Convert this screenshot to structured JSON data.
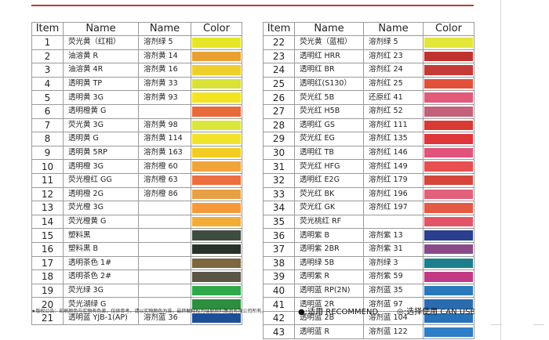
{
  "headers": {
    "item": "Item",
    "name1": "Name",
    "name2": "Name",
    "color": "Color"
  },
  "left_rows": [
    {
      "item": "1",
      "name1": "荧光黄（红相）",
      "name2": "溶剂绿 5",
      "color": "#e6e627"
    },
    {
      "item": "2",
      "name1": "油溶黄 R",
      "name2": "溶剂黄 14",
      "color": "#e8a033"
    },
    {
      "item": "3",
      "name1": "油溶黄 4R",
      "name2": "溶剂黄 16",
      "color": "#f0cf2a"
    },
    {
      "item": "4",
      "name1": "透明黄 TP",
      "name2": "溶剂黄 33",
      "color": "#d9e236"
    },
    {
      "item": "5",
      "name1": "透明黄 3G",
      "name2": "溶剂黄  93",
      "color": "#f2e51f"
    },
    {
      "item": "6",
      "name1": "透明橙黄 G",
      "name2": "",
      "color": "#e8693a"
    },
    {
      "item": "7",
      "name1": "荧光黄 3G",
      "name2": "溶剂黄 98",
      "color": "#dbe63a"
    },
    {
      "item": "8",
      "name1": "透明黄 G",
      "name2": "溶剂黄 114",
      "color": "#f2e22a"
    },
    {
      "item": "9",
      "name1": "透明黄 5RP",
      "name2": "溶剂黄 163",
      "color": "#f3cc22"
    },
    {
      "item": "10",
      "name1": "透明橙  3G",
      "name2": "溶剂橙 60",
      "color": "#f0a53a"
    },
    {
      "item": "11",
      "name1": "荧光橙红 GG",
      "name2": "溶剂橙 63",
      "color": "#ec6e3e"
    },
    {
      "item": "12",
      "name1": "透明橙  2G",
      "name2": "溶剂橙  86",
      "color": "#e8a044"
    },
    {
      "item": "13",
      "name1": "荧光橙 3G",
      "name2": "",
      "color": "#f59a3a"
    },
    {
      "item": "14",
      "name1": "荧光橙黄 G",
      "name2": "",
      "color": "#f3ad34"
    },
    {
      "item": "15",
      "name1": "塑料黑",
      "name2": "",
      "color": "#3f4d3f"
    },
    {
      "item": "16",
      "name1": "塑料黑 B",
      "name2": "",
      "color": "#27332a"
    },
    {
      "item": "17",
      "name1": "透明茶色 1#",
      "name2": "",
      "color": "#7d6840"
    },
    {
      "item": "18",
      "name1": "透明茶色 2#",
      "name2": "",
      "color": "#5b5545"
    },
    {
      "item": "19",
      "name1": "荧光绿  3G",
      "name2": "",
      "color": "#2fa84a"
    },
    {
      "item": "20",
      "name1": "荧光湖绿 G",
      "name2": "",
      "color": "#2d8f3e"
    },
    {
      "item": "21",
      "name1": "透明蓝 YJB-1(AP)",
      "name2": "溶剂蓝 36",
      "color": "#1d4f97"
    }
  ],
  "right_rows": [
    {
      "item": "22",
      "name1": "荧光黄（蓝相）",
      "name2": "溶剂绿 5",
      "color": "#e4e63a"
    },
    {
      "item": "23",
      "name1": "透明红 HRR",
      "name2": "溶剂红 23",
      "color": "#c0332f"
    },
    {
      "item": "24",
      "name1": "透明红 BR",
      "name2": "溶剂红 24",
      "color": "#c63a36"
    },
    {
      "item": "25",
      "name1": "透明红(S130）",
      "name2": "溶剂红 25",
      "color": "#e2503a"
    },
    {
      "item": "26",
      "name1": "荧光红 5B",
      "name2": "还原红 41",
      "color": "#e15a7a"
    },
    {
      "item": "27",
      "name1": "荧光红 H5B",
      "name2": "溶剂红 52",
      "color": "#c5607a"
    },
    {
      "item": "28",
      "name1": "透明红 GS",
      "name2": "溶剂红 111",
      "color": "#d93a34"
    },
    {
      "item": "29",
      "name1": "荧光红 EG",
      "name2": "溶剂红 135",
      "color": "#e0353a"
    },
    {
      "item": "30",
      "name1": "透明红 TB",
      "name2": "溶剂红 146",
      "color": "#e2527a"
    },
    {
      "item": "31",
      "name1": "荧光红 HFG",
      "name2": "溶剂红 149",
      "color": "#e65050"
    },
    {
      "item": "32",
      "name1": "透明红 E2G",
      "name2": "溶剂红 179",
      "color": "#d6453a"
    },
    {
      "item": "33",
      "name1": "荧光红 BK",
      "name2": "溶剂红 196",
      "color": "#e2607c"
    },
    {
      "item": "34",
      "name1": "荧光红 GK",
      "name2": "溶剂红 197",
      "color": "#e55a45"
    },
    {
      "item": "35",
      "name1": "荧光桃红 RF",
      "name2": "",
      "color": "#e45468"
    },
    {
      "item": "36",
      "name1": "透明紫 B",
      "name2": "溶剂紫 13",
      "color": "#2b3f8f"
    },
    {
      "item": "37",
      "name1": "透明紫 2BR",
      "name2": "溶剂紫 31",
      "color": "#8a4a8a"
    },
    {
      "item": "38",
      "name1": "透明绿 5B",
      "name2": "溶剂绿 3",
      "color": "#1c7f8e"
    },
    {
      "item": "39",
      "name1": "透明紫 R",
      "name2": "溶剂紫 59",
      "color": "#c23a84"
    },
    {
      "item": "40",
      "name1": "透明蓝 RP(2N)",
      "name2": "溶剂蓝 35",
      "color": "#2a79bd"
    },
    {
      "item": "41",
      "name1": "透明蓝 2R",
      "name2": "溶剂蓝 97",
      "color": "#2b6cb0"
    },
    {
      "item": "42",
      "name1": "透明蓝 2B",
      "name2": "溶剂蓝 104",
      "color": "#2672b8"
    },
    {
      "item": "43",
      "name1": "透明蓝 R",
      "name2": "溶剂蓝 122",
      "color": "#2d7ec4"
    }
  ],
  "footer": {
    "note": "★版权公告：印刷颜色与实物有色差，仅供参考，请以实物颜色为准，最终解释权为瑞丽颜料集团有限公司所有。",
    "recommend": "●:适用 RECOMMEND",
    "can_use": "◎:选择使用  CAN USE"
  }
}
